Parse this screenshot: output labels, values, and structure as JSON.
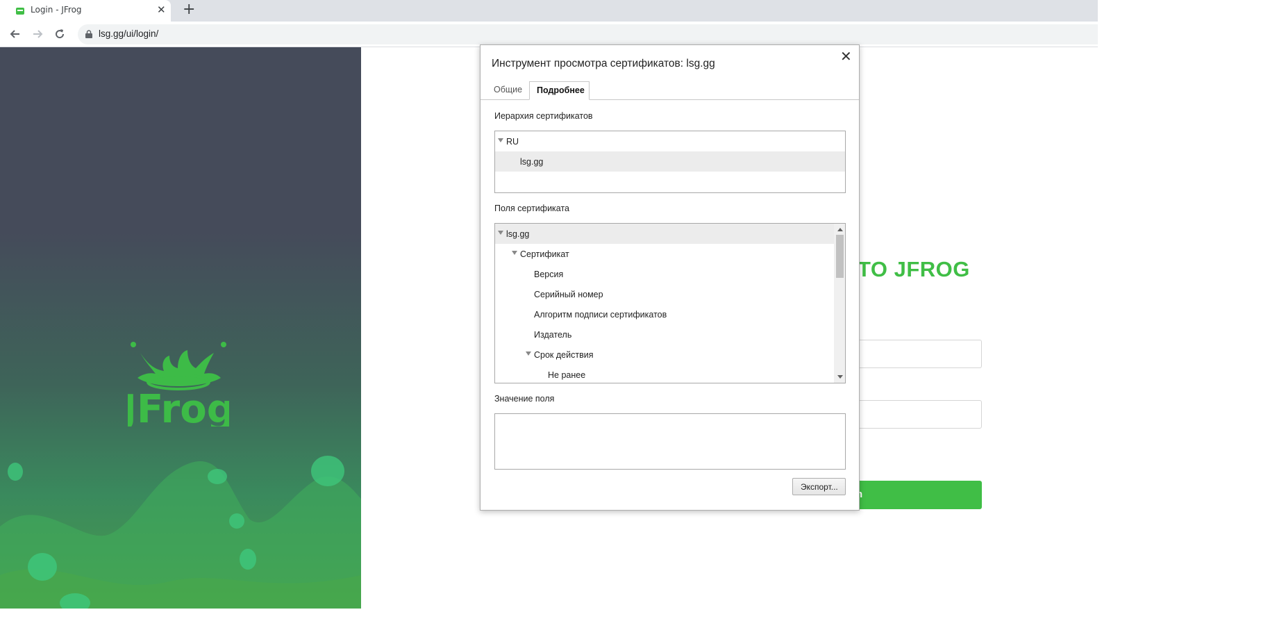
{
  "browser": {
    "tab_title": "Login - JFrog",
    "tab_close": "✕",
    "new_tab": "+",
    "url": "lsg.gg/ui/login/",
    "icons": [
      "back-icon",
      "forward-icon",
      "reload-icon",
      "lock-icon",
      "jfrog-favicon"
    ]
  },
  "page": {
    "welcome_text": "TO JFROG",
    "login_button_text": "n",
    "brand_logo_text": "JFrog",
    "accent_color": "#40be46"
  },
  "dialog": {
    "title": "Инструмент просмотра сертификатов: lsg.gg",
    "close": "✕",
    "tabs": [
      {
        "label": "Общие",
        "active": false
      },
      {
        "label": "Подробнее",
        "active": true
      }
    ],
    "hierarchy_label": "Иерархия сертификатов",
    "hierarchy": [
      {
        "label": "RU",
        "expanded": true,
        "selected": false
      },
      {
        "label": "lsg.gg",
        "selected": true
      }
    ],
    "fields_label": "Поля сертификата",
    "fields": [
      {
        "label": "lsg.gg",
        "expanded": true,
        "selected": true
      },
      {
        "label": "Сертификат",
        "expanded": true
      },
      {
        "label": "Версия"
      },
      {
        "label": "Серийный номер"
      },
      {
        "label": "Алгоритм подписи сертификатов"
      },
      {
        "label": "Издатель"
      },
      {
        "label": "Срок действия",
        "expanded": true
      },
      {
        "label": "Не ранее"
      }
    ],
    "value_label": "Значение поля",
    "export_button": "Экспорт..."
  }
}
